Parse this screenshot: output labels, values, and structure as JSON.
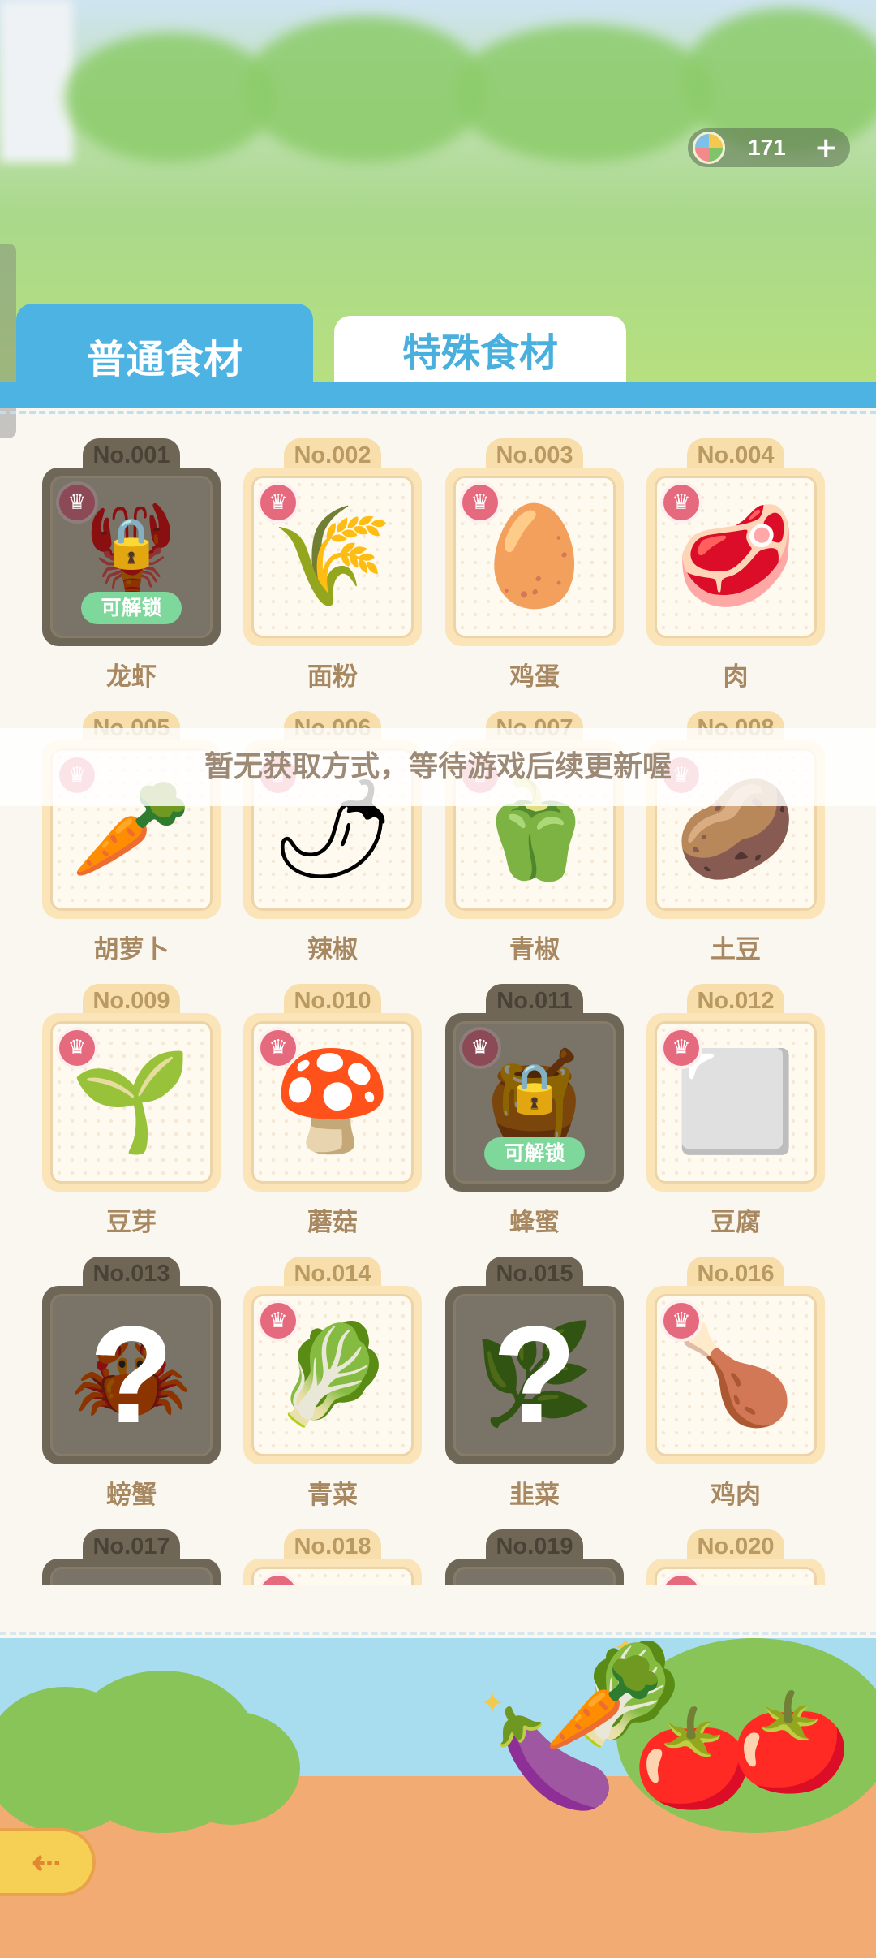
{
  "currency": {
    "amount": "171",
    "icon": "rainbow-coin-icon",
    "add_symbol": "+"
  },
  "tabs": [
    {
      "label": "普通食材",
      "active": true
    },
    {
      "label": "特殊食材",
      "active": false
    }
  ],
  "toast": "暂无获取方式，等待游戏后续更新喔",
  "unlock_label": "可解锁",
  "unknown_symbol": "?",
  "badge_symbol": "♛",
  "lock_symbol": "🔒",
  "items": [
    {
      "no": "No.001",
      "name": "龙虾",
      "state": "locked",
      "icon": "🦞"
    },
    {
      "no": "No.002",
      "name": "面粉",
      "state": "owned",
      "icon": "🌾"
    },
    {
      "no": "No.003",
      "name": "鸡蛋",
      "state": "owned",
      "icon": "🥚"
    },
    {
      "no": "No.004",
      "name": "肉",
      "state": "owned",
      "icon": "🥩"
    },
    {
      "no": "No.005",
      "name": "胡萝卜",
      "state": "owned",
      "icon": "🥕"
    },
    {
      "no": "No.006",
      "name": "辣椒",
      "state": "owned",
      "icon": "🌶"
    },
    {
      "no": "No.007",
      "name": "青椒",
      "state": "owned",
      "icon": "🫑"
    },
    {
      "no": "No.008",
      "name": "土豆",
      "state": "owned",
      "icon": "🥔"
    },
    {
      "no": "No.009",
      "name": "豆芽",
      "state": "owned",
      "icon": "🌱"
    },
    {
      "no": "No.010",
      "name": "蘑菇",
      "state": "owned",
      "icon": "🍄"
    },
    {
      "no": "No.011",
      "name": "蜂蜜",
      "state": "locked",
      "icon": "🍯"
    },
    {
      "no": "No.012",
      "name": "豆腐",
      "state": "owned",
      "icon": "⬜"
    },
    {
      "no": "No.013",
      "name": "螃蟹",
      "state": "unknown",
      "icon": "🦀"
    },
    {
      "no": "No.014",
      "name": "青菜",
      "state": "owned",
      "icon": "🥬"
    },
    {
      "no": "No.015",
      "name": "韭菜",
      "state": "unknown",
      "icon": "🌿"
    },
    {
      "no": "No.016",
      "name": "鸡肉",
      "state": "owned",
      "icon": "🍗"
    },
    {
      "no": "No.017",
      "name": "",
      "state": "unknown",
      "icon": ""
    },
    {
      "no": "No.018",
      "name": "",
      "state": "owned",
      "icon": ""
    },
    {
      "no": "No.019",
      "name": "",
      "state": "unknown",
      "icon": ""
    },
    {
      "no": "No.020",
      "name": "",
      "state": "owned",
      "icon": ""
    }
  ],
  "footer": {
    "vegetables": [
      "🍆",
      "🥕",
      "🍅",
      "🍅",
      "🥬"
    ],
    "back_icon": "back-arrow-icon",
    "back_symbol": "⇠"
  }
}
